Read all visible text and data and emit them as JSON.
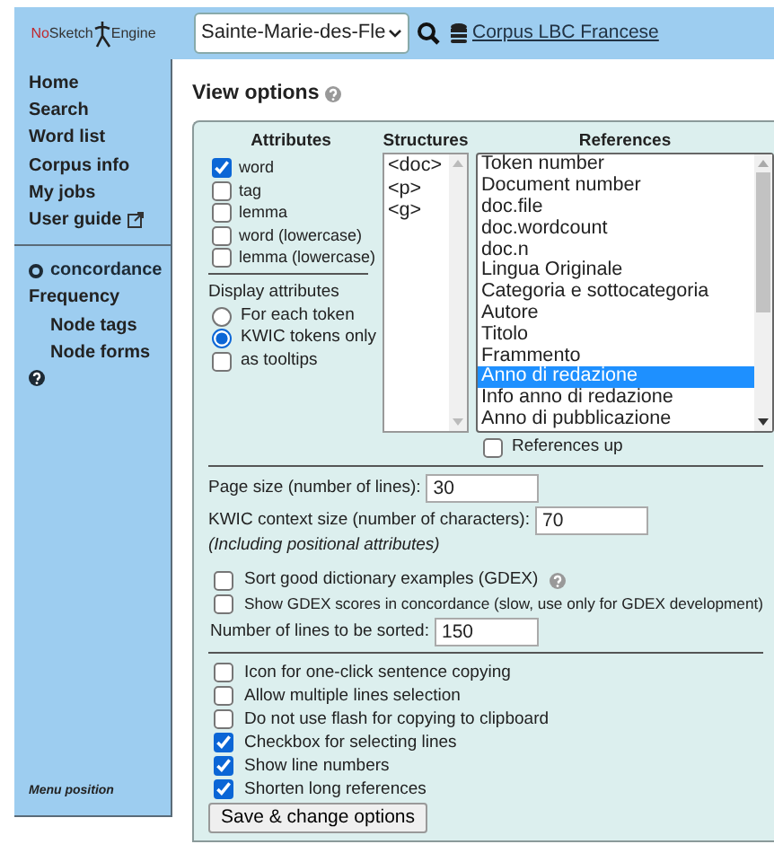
{
  "header": {
    "logo": {
      "parts": [
        "No",
        "Sketch",
        "Engine"
      ]
    },
    "corpus_select": {
      "value": "Sainte-Marie-des-Fle"
    },
    "corpus_link": "Corpus LBC Francese"
  },
  "sidebar": {
    "items": [
      {
        "label": "Home",
        "kind": "link"
      },
      {
        "label": "Search",
        "kind": "link"
      },
      {
        "label": "Word list",
        "kind": "link"
      },
      {
        "label": "Corpus info",
        "kind": "link"
      },
      {
        "label": "My jobs",
        "kind": "link"
      },
      {
        "label": "User guide",
        "kind": "external"
      },
      {
        "label": "concordance",
        "kind": "section"
      },
      {
        "label": "Frequency",
        "kind": "link"
      },
      {
        "label": "Node tags",
        "kind": "sub"
      },
      {
        "label": "Node forms",
        "kind": "sub"
      },
      {
        "kind": "help"
      }
    ],
    "menu_position": "Menu position"
  },
  "title": "View options",
  "attributes": {
    "heading": "Attributes",
    "items": [
      {
        "label": "word",
        "checked": true
      },
      {
        "label": "tag",
        "checked": false
      },
      {
        "label": "lemma",
        "checked": false
      },
      {
        "label": "word (lowercase)",
        "checked": false
      },
      {
        "label": "lemma (lowercase)",
        "checked": false
      }
    ],
    "display_heading": "Display attributes",
    "display": [
      {
        "label": "For each token",
        "selected": false
      },
      {
        "label": "KWIC tokens only",
        "selected": true
      }
    ],
    "tooltips": {
      "label": "as tooltips",
      "checked": false
    }
  },
  "structures": {
    "heading": "Structures",
    "items": [
      "<doc>",
      "<p>",
      "<g>"
    ]
  },
  "references": {
    "heading": "References",
    "items": [
      {
        "label": "Token number",
        "selected": false
      },
      {
        "label": "Document number",
        "selected": false
      },
      {
        "label": "doc.file",
        "selected": false
      },
      {
        "label": "doc.wordcount",
        "selected": false
      },
      {
        "label": "doc.n",
        "selected": false
      },
      {
        "label": "Lingua Originale",
        "selected": false
      },
      {
        "label": "Categoria e sottocategoria",
        "selected": false
      },
      {
        "label": "Autore",
        "selected": false
      },
      {
        "label": "Titolo",
        "selected": false
      },
      {
        "label": "Frammento",
        "selected": false
      },
      {
        "label": "Anno di redazione",
        "selected": true
      },
      {
        "label": "Info anno di redazione",
        "selected": false
      },
      {
        "label": "Anno di pubblicazione",
        "selected": false
      }
    ],
    "up": {
      "label": "References up",
      "checked": false
    }
  },
  "sizes": [
    {
      "label": "Page size (number of lines):",
      "value": "30"
    },
    {
      "label": "KWIC context size (number of characters):",
      "value": "70"
    }
  ],
  "sizes_note": "(Including positional attributes)",
  "gdex": [
    {
      "label": "Sort good dictionary examples (GDEX)",
      "checked": false,
      "help": true
    },
    {
      "label": "Show GDEX scores in concordance (slow, use only for GDEX development)",
      "checked": false,
      "help": false
    }
  ],
  "sort_lines": {
    "label": "Number of lines to be sorted:",
    "value": "150"
  },
  "options": [
    {
      "label": "Icon for one-click sentence copying",
      "checked": false
    },
    {
      "label": "Allow multiple lines selection",
      "checked": false
    },
    {
      "label": "Do not use flash for copying to clipboard",
      "checked": false
    },
    {
      "label": "Checkbox for selecting lines",
      "checked": true
    },
    {
      "label": "Show line numbers",
      "checked": true
    },
    {
      "label": "Shorten long references",
      "checked": true
    }
  ],
  "save_button": "Save & change options"
}
